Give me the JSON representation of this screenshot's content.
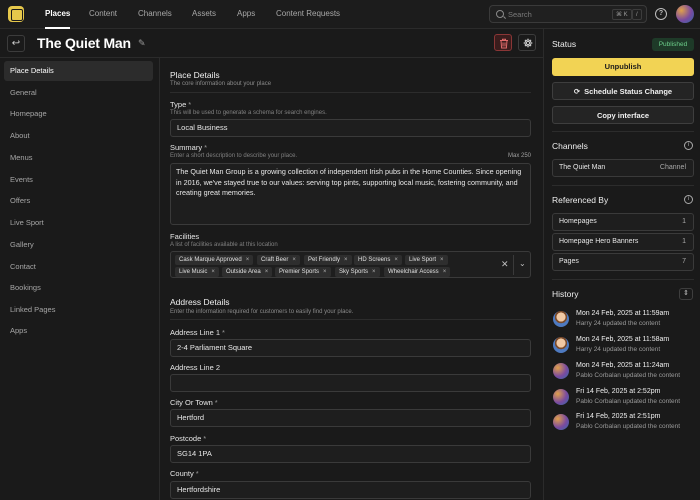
{
  "nav": {
    "tabs": [
      {
        "label": "Places",
        "active": true
      },
      {
        "label": "Content"
      },
      {
        "label": "Channels"
      },
      {
        "label": "Assets"
      },
      {
        "label": "Apps"
      },
      {
        "label": "Content Requests"
      }
    ],
    "search_placeholder": "Search",
    "shortcut_keys": [
      "⌘ K",
      "/"
    ],
    "help_icon": "question-circle-icon",
    "avatar_icon": "gradient-avatar"
  },
  "header": {
    "title": "The Quiet Man",
    "back_icon": "return-arrow-icon",
    "edit_icon": "pencil-icon",
    "delete_icon": "trash-icon",
    "settings_icon": "gear-icon"
  },
  "sidebar": {
    "items": [
      "Place Details",
      "General",
      "Homepage",
      "About",
      "Menus",
      "Events",
      "Offers",
      "Live Sport",
      "Gallery",
      "Contact",
      "Bookings",
      "Linked Pages",
      "Apps"
    ],
    "active": "Place Details"
  },
  "form": {
    "place_details": {
      "title": "Place Details",
      "subtitle": "The core information about your place"
    },
    "type": {
      "label": "Type",
      "required_mark": "*",
      "help": "This will be used to generate a schema for search engines.",
      "value": "Local Business"
    },
    "summary": {
      "label": "Summary",
      "required_mark": "*",
      "help": "Enter a short description to describe your place.",
      "max": "Max 250",
      "value": "The Quiet Man Group is a growing collection of independent Irish pubs in the Home Counties. Since opening in 2016, we've stayed true to our values: serving top pints, supporting local music, fostering community, and creating great memories."
    },
    "facilities": {
      "label": "Facilities",
      "help": "A list of facilities available at this location",
      "chips": [
        "Cask Marque Approved",
        "Craft Beer",
        "Pet Friendly",
        "HD Screens",
        "Live Sport",
        "Live Music",
        "Outside Area",
        "Premier Sports",
        "Sky Sports",
        "Wheelchair Access"
      ],
      "clear_icon": "x-icon",
      "dropdown_icon": "chevron-down-icon"
    },
    "address_details": {
      "title": "Address Details",
      "subtitle": "Enter the information required for customers to easily find your place."
    },
    "address_line_1": {
      "label": "Address Line 1",
      "required_mark": "*",
      "value": "2-4 Parliament Square"
    },
    "address_line_2": {
      "label": "Address Line 2",
      "value": ""
    },
    "city": {
      "label": "City Or Town",
      "required_mark": "*",
      "value": "Hertford"
    },
    "postcode": {
      "label": "Postcode",
      "required_mark": "*",
      "value": "SG14 1PA"
    },
    "county": {
      "label": "County",
      "required_mark": "*",
      "value": "Hertfordshire"
    }
  },
  "status": {
    "title": "Status",
    "badge": "Published",
    "badge_color": "#6ccf8a",
    "unpublish": "Unpublish",
    "schedule": "Schedule Status Change",
    "interface": "Copy interface",
    "accent_color": "#f2d354"
  },
  "channels": {
    "title": "Channels",
    "items": [
      {
        "name": "The Quiet Man",
        "type": "Channel"
      }
    ]
  },
  "referenced_by": {
    "title": "Referenced By",
    "items": [
      {
        "name": "Homepages",
        "count": "1"
      },
      {
        "name": "Homepage Hero Banners",
        "count": "1"
      },
      {
        "name": "Pages",
        "count": "7"
      }
    ]
  },
  "history": {
    "title": "History",
    "items": [
      {
        "time": "Mon 24 Feb, 2025 at 11:59am",
        "desc": "Harry 24 updated the content",
        "avatar": "harry"
      },
      {
        "time": "Mon 24 Feb, 2025 at 11:58am",
        "desc": "Harry 24 updated the content",
        "avatar": "harry"
      },
      {
        "time": "Mon 24 Feb, 2025 at 11:24am",
        "desc": "Pablo Corbalan updated the content",
        "avatar": "pablo"
      },
      {
        "time": "Fri 14 Feb, 2025 at 2:52pm",
        "desc": "Pablo Corbalan updated the content",
        "avatar": "pablo"
      },
      {
        "time": "Fri 14 Feb, 2025 at 2:51pm",
        "desc": "Pablo Corbalan updated the content",
        "avatar": "pablo"
      }
    ]
  }
}
